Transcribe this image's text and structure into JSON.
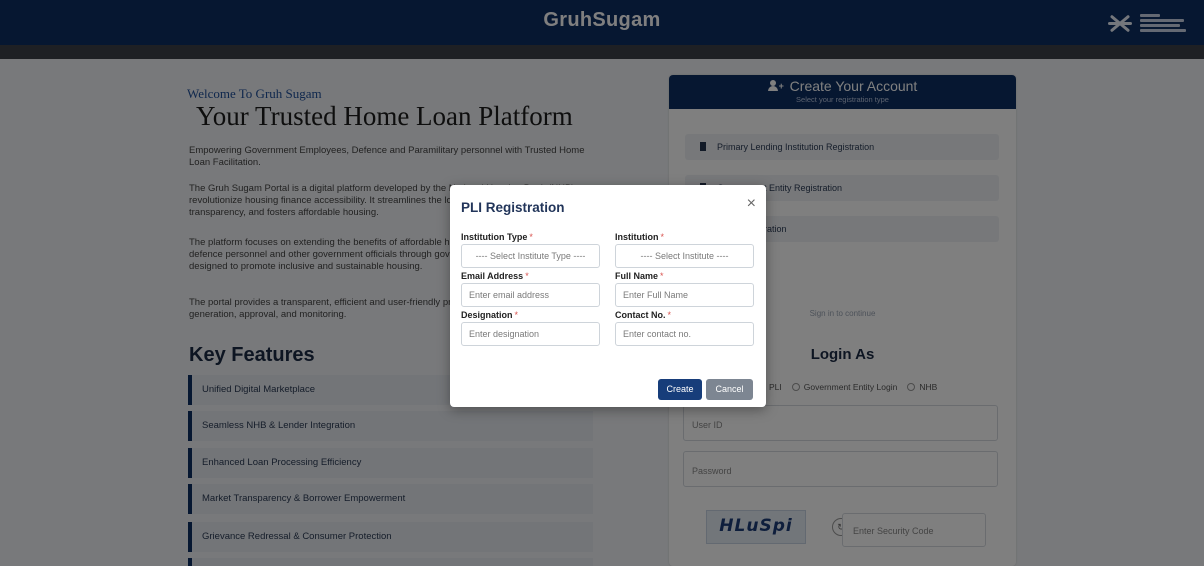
{
  "header": {
    "title": "GruhSugam"
  },
  "intro": {
    "welcome": "Welcome To Gruh Sugam",
    "headline": "Your Trusted Home Loan Platform",
    "p1": "Empowering Government Employees, Defence and Paramilitary personnel with Trusted Home Loan Facilitation.",
    "p2": "The Gruh Sugam Portal is a digital platform developed by the National Housing Bank (NHB) to revolutionize housing finance accessibility. It streamlines the loan process, enhances transparency, and fosters affordable housing.",
    "p3": "The platform focuses on extending the benefits of affordable home loans to serving and retired defence personnel and other government officials through government supported schemes designed to promote inclusive and sustainable housing.",
    "p4": "The portal provides a transparent, efficient and user-friendly process for loan application, offer generation, approval, and monitoring."
  },
  "features": {
    "title": "Key Features",
    "items": [
      "Unified Digital Marketplace",
      "Seamless NHB & Lender Integration",
      "Enhanced Loan Processing Efficiency",
      "Market Transparency & Borrower Empowerment",
      "Grievance Redressal & Consumer Protection"
    ]
  },
  "account": {
    "title": "Create Your Account",
    "subtitle": "Select your registration type",
    "options": [
      "Primary Lending Institution Registration",
      "Government Entity Registration",
      "NHB Registration"
    ],
    "signin_hint": "Sign in to continue",
    "login_as": "Login As",
    "radio_options": [
      "PLI",
      "Government Entity Login",
      "NHB"
    ],
    "user_id_placeholder": "User ID",
    "password_placeholder": "Password",
    "captcha_text": "HLuSpi",
    "security_code_placeholder": "Enter Security Code"
  },
  "modal": {
    "title": "PLI Registration",
    "close_glyph": "×",
    "fields": {
      "institution_type_label": "Institution Type",
      "institution_type_value": "---- Select Institute Type ----",
      "institution_label": "Institution",
      "institution_value": "---- Select Institute ----",
      "email_label": "Email Address",
      "email_placeholder": "Enter email address",
      "full_name_label": "Full Name",
      "full_name_placeholder": "Enter Full Name",
      "designation_label": "Designation",
      "designation_placeholder": "Enter designation",
      "contact_label": "Contact No.",
      "contact_placeholder": "Enter contact no."
    },
    "required_mark": "*",
    "create_label": "Create",
    "cancel_label": "Cancel"
  },
  "colors": {
    "brand_navy": "#0d2e63",
    "required_red": "#d9534f",
    "cancel_gray": "#7d8692"
  }
}
